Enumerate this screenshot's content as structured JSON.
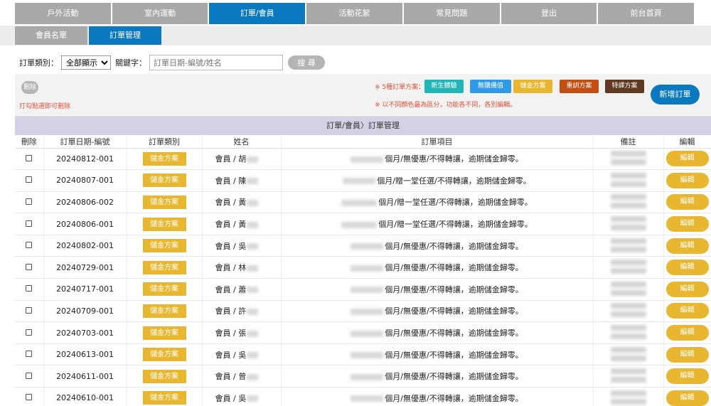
{
  "top_nav": [
    {
      "label": "戶外活動",
      "active": false
    },
    {
      "label": "室內運動",
      "active": false
    },
    {
      "label": "訂單/會員",
      "active": true
    },
    {
      "label": "活動花絮",
      "active": false
    },
    {
      "label": "常見問題",
      "active": false
    },
    {
      "label": "登出",
      "active": false
    },
    {
      "label": "前台首頁",
      "active": false
    }
  ],
  "sub_nav": [
    {
      "label": "會員名單",
      "active": false
    },
    {
      "label": "訂單管理",
      "active": true
    }
  ],
  "filter": {
    "category_label": "訂單類別：",
    "category_value": "全部顯示",
    "keyword_label": "關鍵字：",
    "keyword_placeholder": "訂單日期-編號/姓名",
    "search_label": "搜 尋"
  },
  "toolbar": {
    "delete_label": "刪除",
    "delete_hint": "打勾點選即可刪除",
    "legend_label": "※ 5種訂單方案：",
    "legend_note": "※ 以不同顏色最為區分，功能各不同，各別編輯。",
    "add_label": "新增訂單",
    "plans": [
      {
        "label": "新生體驗",
        "color": "#22b5b5"
      },
      {
        "label": "無購備值",
        "color": "#2f9be8"
      },
      {
        "label": "儲金方案",
        "color": "#e8b62f"
      },
      {
        "label": "重訓方案",
        "color": "#c24e12"
      },
      {
        "label": "特課方案",
        "color": "#5e3a22"
      }
    ]
  },
  "table": {
    "title": "訂單/會員〉訂單管理",
    "headers": [
      "刪除",
      "訂單日期-編號",
      "訂單類別",
      "姓名",
      "訂單項目",
      "備註",
      "編輯"
    ],
    "member_prefix": "會員 /",
    "edit_label": "編輯",
    "rows": [
      {
        "date_no": "20240812-001",
        "type": "儲金方案",
        "initial": "胡",
        "item": "個月/無優惠/不得轉讓，逾期儲金歸零。"
      },
      {
        "date_no": "20240807-001",
        "type": "儲金方案",
        "initial": "陳",
        "item": "個月/贈一堂任選/不得轉讓，逾期儲金歸零。"
      },
      {
        "date_no": "20240806-002",
        "type": "儲金方案",
        "initial": "黃",
        "item": "個月/贈一堂任選/不得轉讓，逾期儲金歸零。"
      },
      {
        "date_no": "20240806-001",
        "type": "儲金方案",
        "initial": "黃",
        "item": "個月/贈一堂任選/不得轉讓，逾期儲金歸零。"
      },
      {
        "date_no": "20240802-001",
        "type": "儲金方案",
        "initial": "吳",
        "item": "個月/無優惠/不得轉讓，逾期儲金歸零。"
      },
      {
        "date_no": "20240729-001",
        "type": "儲金方案",
        "initial": "林",
        "item": "個月/無優惠/不得轉讓，逾期儲金歸零。"
      },
      {
        "date_no": "20240717-001",
        "type": "儲金方案",
        "initial": "蕭",
        "item": "個月/無優惠/不得轉讓，逾期儲金歸零。"
      },
      {
        "date_no": "20240709-001",
        "type": "儲金方案",
        "initial": "許",
        "item": "個月/無優惠/不得轉讓，逾期儲金歸零。"
      },
      {
        "date_no": "20240703-001",
        "type": "儲金方案",
        "initial": "張",
        "item": "個月/無優惠/不得轉讓，逾期儲金歸零。"
      },
      {
        "date_no": "20240613-001",
        "type": "儲金方案",
        "initial": "吳",
        "item": "個月/無優惠/不得轉讓，逾期儲金歸零。"
      },
      {
        "date_no": "20240611-001",
        "type": "儲金方案",
        "initial": "曾",
        "item": "個月/無優惠/不得轉讓，逾期儲金歸零。"
      },
      {
        "date_no": "20240610-001",
        "type": "儲金方案",
        "initial": "吳",
        "item": "個月/無優惠/不得轉讓，逾期儲金歸零。"
      }
    ]
  }
}
